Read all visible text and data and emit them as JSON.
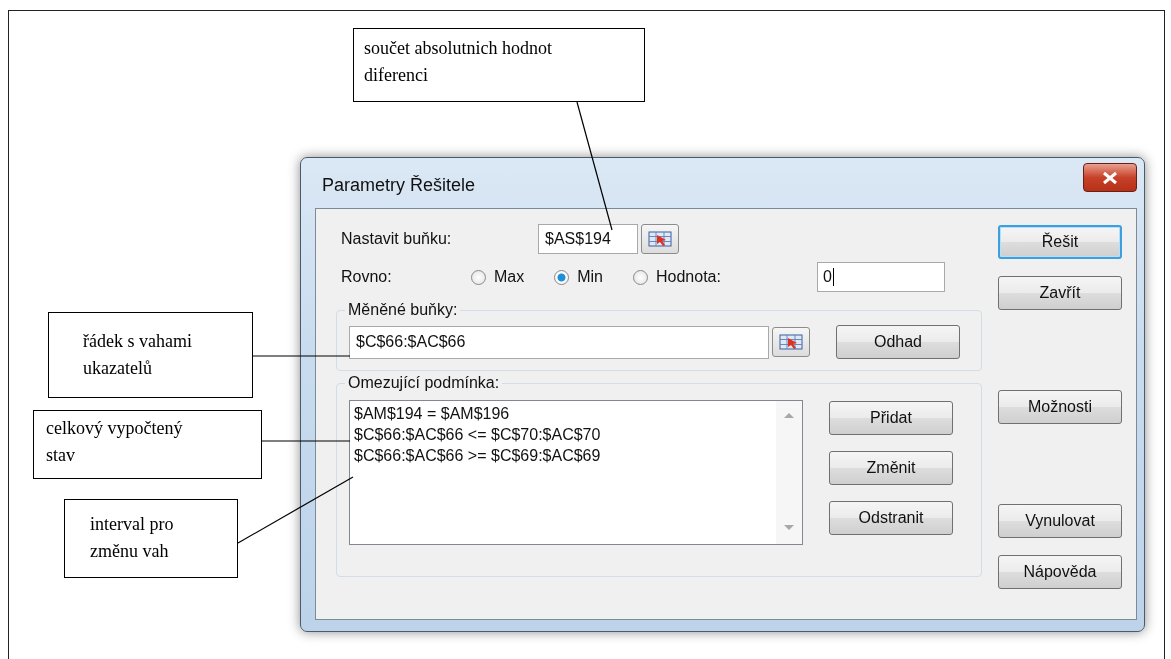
{
  "annotations": [
    {
      "text": "součet absolutnich hodnot\ndiferenci"
    },
    {
      "text": "řádek s vahami\nukazatelů"
    },
    {
      "text": "celkový vypočtený\nstav"
    },
    {
      "text": "interval pro\nzměnu vah"
    }
  ],
  "dialog": {
    "title": "Parametry Řešitele",
    "target_cell": {
      "label": "Nastavit buňku:",
      "value": "$AS$194"
    },
    "equal_to": {
      "label": "Rovno:",
      "options": [
        {
          "label": "Max",
          "selected": false
        },
        {
          "label": "Min",
          "selected": true
        },
        {
          "label": "Hodnota:",
          "selected": false
        }
      ],
      "value": "0"
    },
    "changing_cells": {
      "label": "Měněné buňky:",
      "value": "$C$66:$AC$66",
      "button": "Odhad"
    },
    "constraints": {
      "label": "Omezující podmínka:",
      "items": [
        "$AM$194 = $AM$196",
        "$C$66:$AC$66 <= $C$70:$AC$70",
        "$C$66:$AC$66 >= $C$69:$AC$69"
      ],
      "buttons": [
        "Přidat",
        "Změnit",
        "Odstranit"
      ]
    },
    "side_buttons": [
      {
        "label": "Řešit",
        "focused": true
      },
      {
        "label": "Zavřít",
        "focused": false
      },
      {
        "label": "Možnosti",
        "focused": false
      },
      {
        "label": "Vynulovat",
        "focused": false
      },
      {
        "label": "Nápověda",
        "focused": false
      }
    ]
  }
}
